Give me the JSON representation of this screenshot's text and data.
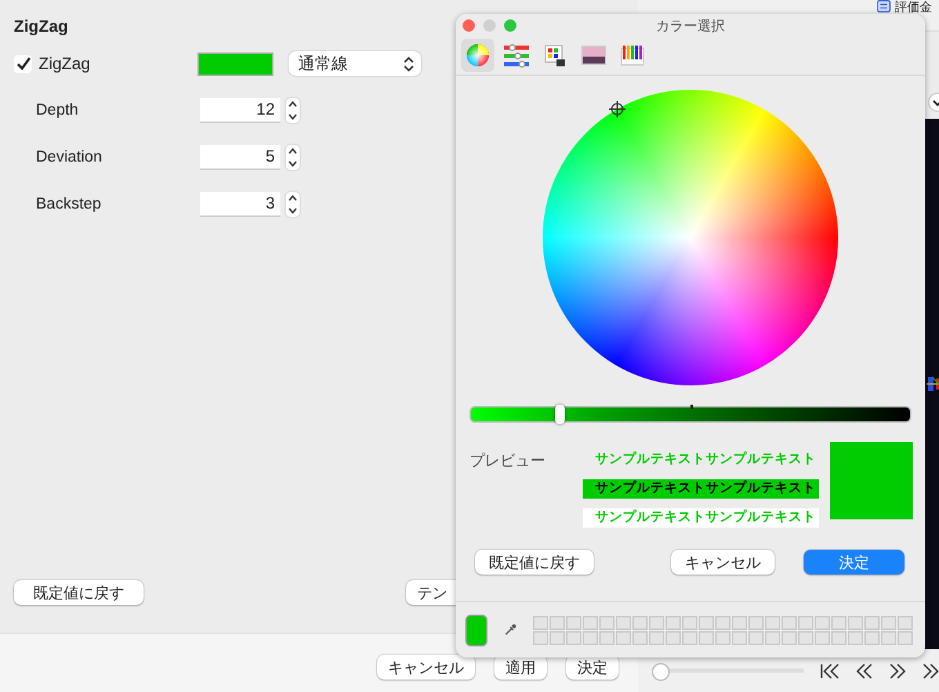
{
  "settings": {
    "title": "ZigZag",
    "zigzag": {
      "label": "ZigZag",
      "checked": true,
      "color": "#00cc00",
      "line_style": "通常線"
    },
    "params": [
      {
        "label": "Depth",
        "value": "12"
      },
      {
        "label": "Deviation",
        "value": "5"
      },
      {
        "label": "Backstep",
        "value": "3"
      }
    ],
    "reset_button": "既定値に戻す",
    "template_button": "テン"
  },
  "dialog_buttons": [
    "キャンセル",
    "適用",
    "決定"
  ],
  "background_app": {
    "toolbar_text": "評価金",
    "scroll": {
      "level": 0
    }
  },
  "color_picker": {
    "title": "カラー選択",
    "modes": [
      {
        "kind": "wheel",
        "selected": true
      },
      {
        "kind": "sliders",
        "selected": false
      },
      {
        "kind": "palettes",
        "selected": false
      },
      {
        "kind": "image",
        "selected": false
      },
      {
        "kind": "pencils",
        "selected": false
      }
    ],
    "brightness": {
      "level": 0.2
    },
    "preview_label": "プレビュー",
    "samples": [
      {
        "kind": "on-panel",
        "text": "サンプルテキストサンプルテキスト"
      },
      {
        "kind": "on-color",
        "text": "サンプルテキストサンプルテキスト"
      },
      {
        "kind": "on-white",
        "text": "サンプルテキストサンプルテキスト"
      }
    ],
    "current_swatch": {
      "color": "#00cc00"
    },
    "buttons": [
      {
        "kind": "plain",
        "label": "既定値に戻す"
      },
      {
        "kind": "plain",
        "label": "キャンセル"
      },
      {
        "kind": "primary",
        "label": "決定"
      }
    ]
  }
}
